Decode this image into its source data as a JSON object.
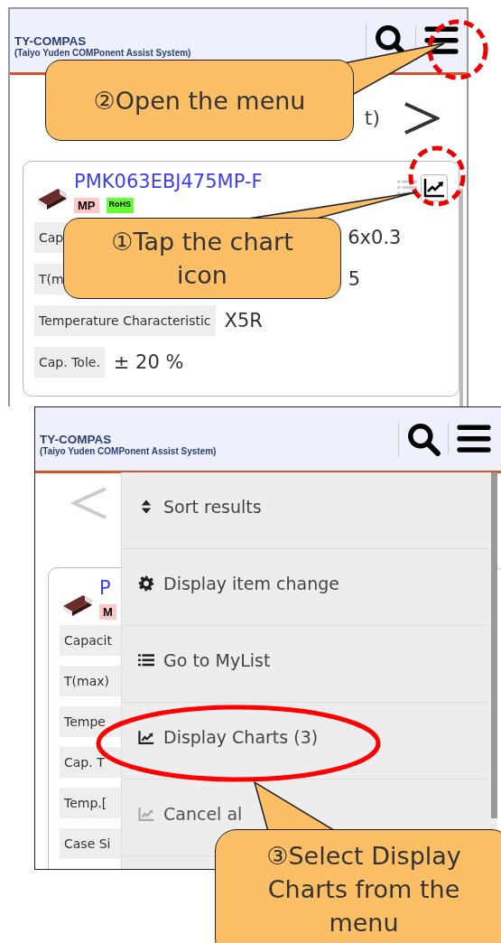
{
  "screens": [
    {
      "header": {
        "title": "TY-COMPAS",
        "subtitle": "(Taiyo Yuden COMPonent Assist System)"
      },
      "nav_text": "t)",
      "card": {
        "part_number": "PMK063EBJ475MP-F",
        "badges": [
          {
            "text": "MP",
            "color": "#ffc8c8"
          },
          {
            "text": "RoHS",
            "color": "#66ff33"
          }
        ],
        "rows": [
          {
            "label": "Cap",
            "value": "6x0.3"
          },
          {
            "label": "T(m",
            "value": "5"
          },
          {
            "label": "Temperature Characteristic",
            "value": "X5R"
          },
          {
            "label": "Cap. Tole.",
            "value": "± 20 %"
          }
        ]
      }
    },
    {
      "header": {
        "title": "TY-COMPAS",
        "subtitle": "(Taiyo Yuden COMPonent Assist System)"
      },
      "card": {
        "part_number": "P",
        "badges": [
          {
            "text": "M",
            "color": "#ffc8c8"
          }
        ],
        "rows": [
          {
            "label": "Capacit"
          },
          {
            "label": "T(max)"
          },
          {
            "label": "Tempe"
          },
          {
            "label": "Cap. T"
          },
          {
            "label": "Temp.["
          },
          {
            "label": "Case Si"
          }
        ]
      },
      "menu": {
        "items": [
          {
            "label": "Sort results",
            "disabled": false
          },
          {
            "label": "Display item change",
            "disabled": false
          },
          {
            "label": "Go to MyList",
            "disabled": false
          },
          {
            "label": "Display Charts (3)",
            "disabled": false
          },
          {
            "label": "Cancel al",
            "disabled": true
          }
        ]
      }
    }
  ],
  "callouts": [
    {
      "text": "②Open the menu"
    },
    {
      "text": "①Tap the chart icon"
    },
    {
      "text": "③Select Display Charts from the menu"
    }
  ]
}
